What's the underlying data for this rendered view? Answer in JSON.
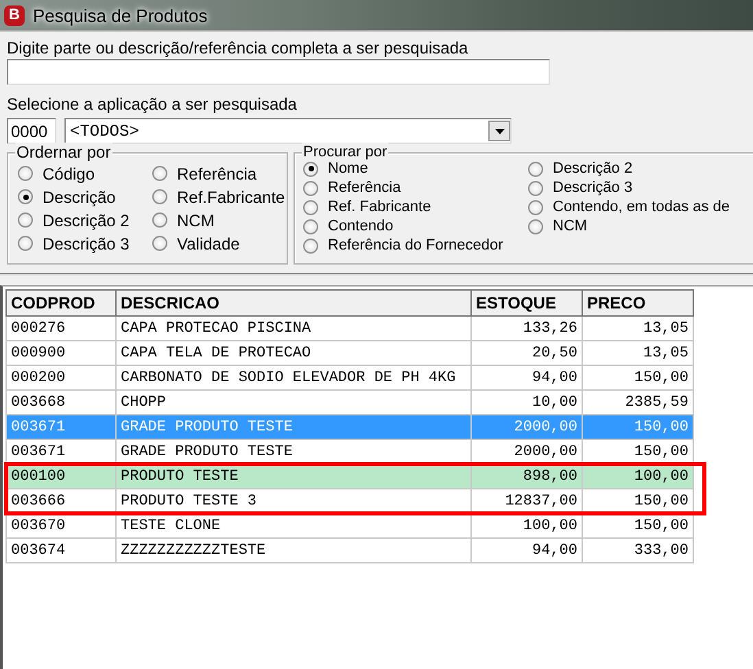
{
  "window": {
    "title": "Pesquisa de Produtos",
    "icon_letter": "B"
  },
  "search": {
    "label": "Digite parte ou  descrição/referência completa a ser pesquisada"
  },
  "application": {
    "label": "Selecione a aplicação a ser pesquisada",
    "code": "0000",
    "value": "<TODOS>"
  },
  "order_by": {
    "title": "Ordernar por",
    "options": [
      {
        "label": "Código",
        "selected": false
      },
      {
        "label": "Descrição",
        "selected": true
      },
      {
        "label": "Descrição 2",
        "selected": false
      },
      {
        "label": "Descrição 3",
        "selected": false
      },
      {
        "label": "Referência",
        "selected": false
      },
      {
        "label": "Ref.Fabricante",
        "selected": false
      },
      {
        "label": "NCM",
        "selected": false
      },
      {
        "label": "Validade",
        "selected": false
      }
    ]
  },
  "search_by": {
    "title": "Procurar por",
    "options": [
      {
        "label": "Nome",
        "selected": true
      },
      {
        "label": "Referência",
        "selected": false
      },
      {
        "label": "Ref. Fabricante",
        "selected": false
      },
      {
        "label": "Contendo",
        "selected": false
      },
      {
        "label": "Referência do Fornecedor",
        "selected": false
      },
      {
        "label": "Descrição 2",
        "selected": false
      },
      {
        "label": "Descrição 3",
        "selected": false
      },
      {
        "label": "Contendo, em todas as de",
        "selected": false
      },
      {
        "label": "NCM",
        "selected": false
      }
    ]
  },
  "table": {
    "columns": [
      "CODPROD",
      "DESCRICAO",
      "ESTOQUE",
      "PRECO"
    ],
    "rows": [
      {
        "cells": [
          "000276",
          "CAPA PROTECAO PISCINA",
          "133,26",
          "13,05"
        ],
        "selected": false,
        "highlighted": false
      },
      {
        "cells": [
          "000900",
          "CAPA TELA DE PROTECAO",
          "20,50",
          "13,05"
        ],
        "selected": false,
        "highlighted": false
      },
      {
        "cells": [
          "000200",
          "CARBONATO DE SODIO ELEVADOR DE PH 4KG",
          "94,00",
          "150,00"
        ],
        "selected": false,
        "highlighted": false
      },
      {
        "cells": [
          "003668",
          "CHOPP",
          "10,00",
          "2385,59"
        ],
        "selected": false,
        "highlighted": false
      },
      {
        "cells": [
          "003671",
          "GRADE PRODUTO TESTE",
          "2000,00",
          "150,00"
        ],
        "selected": true,
        "highlighted": false
      },
      {
        "cells": [
          "003671",
          "GRADE PRODUTO TESTE",
          "2000,00",
          "150,00"
        ],
        "selected": false,
        "highlighted": false
      },
      {
        "cells": [
          "000100",
          "PRODUTO TESTE",
          "898,00",
          "100,00"
        ],
        "selected": false,
        "highlighted": true
      },
      {
        "cells": [
          "003666",
          "PRODUTO TESTE 3",
          "12837,00",
          "150,00"
        ],
        "selected": false,
        "highlighted": false
      },
      {
        "cells": [
          "003670",
          "TESTE CLONE",
          "100,00",
          "150,00"
        ],
        "selected": false,
        "highlighted": false
      },
      {
        "cells": [
          "003674",
          "ZZZZZZZZZZZTESTE",
          "94,00",
          "333,00"
        ],
        "selected": false,
        "highlighted": false
      }
    ]
  },
  "annotation": {
    "kind": "rectangle"
  }
}
